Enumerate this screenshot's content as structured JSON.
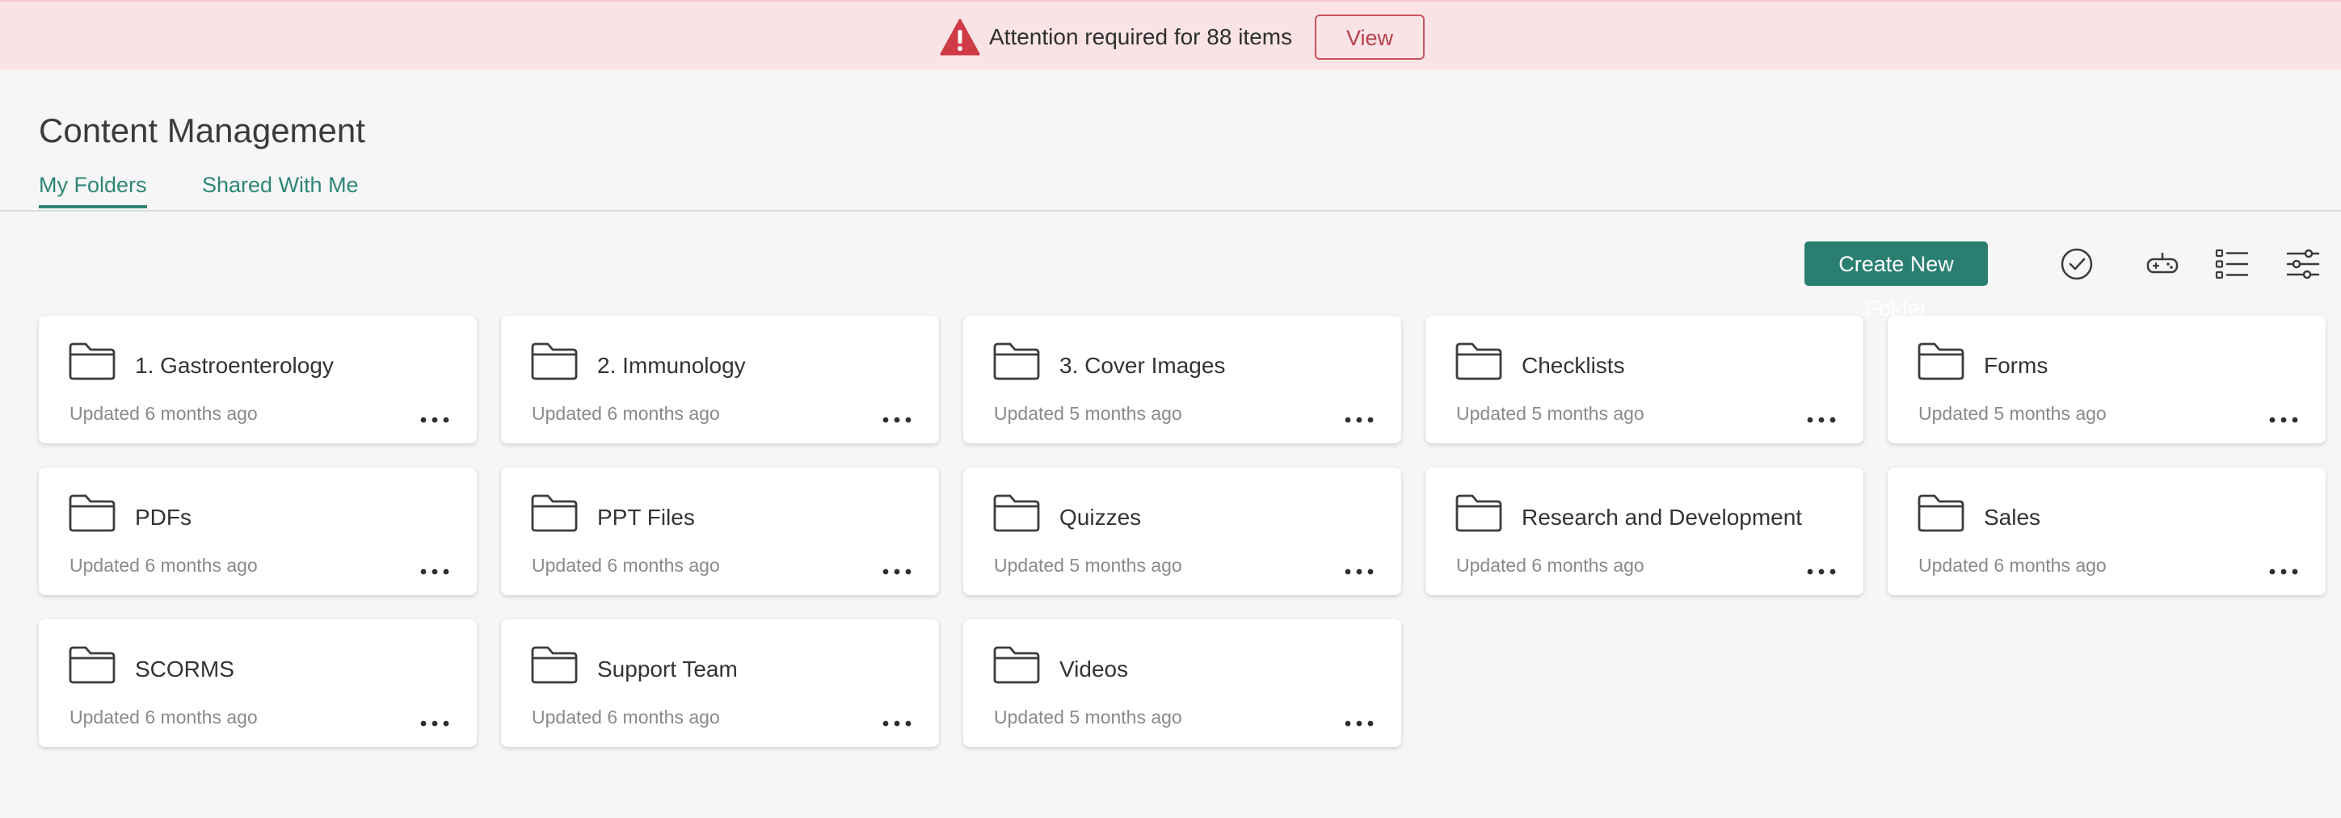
{
  "alert": {
    "icon": "warning-triangle-icon",
    "color": "#d03a45",
    "background": "#f9e3e5",
    "message": "Attention required for 88 items",
    "view_label": "View"
  },
  "header": {
    "title": "Content Management",
    "tabs": [
      {
        "label": "My Folders",
        "active": true
      },
      {
        "label": "Shared With Me",
        "active": false
      }
    ]
  },
  "toolbar": {
    "create_label": "Create New Folder",
    "accent": "#2b7f72",
    "icons": [
      "check-circle-icon",
      "gamepad-icon",
      "list-view-icon",
      "filter-sliders-icon"
    ]
  },
  "folders": [
    {
      "name": "1. Gastroenterology",
      "updated": "Updated 6 months ago"
    },
    {
      "name": "2. Immunology",
      "updated": "Updated 6 months ago"
    },
    {
      "name": "3. Cover Images",
      "updated": "Updated 5 months ago"
    },
    {
      "name": "Checklists",
      "updated": "Updated 5 months ago"
    },
    {
      "name": "Forms",
      "updated": "Updated 5 months ago"
    },
    {
      "name": "PDFs",
      "updated": "Updated 6 months ago"
    },
    {
      "name": "PPT Files",
      "updated": "Updated 6 months ago"
    },
    {
      "name": "Quizzes",
      "updated": "Updated 5 months ago"
    },
    {
      "name": "Research and Development",
      "updated": "Updated 6 months ago"
    },
    {
      "name": "Sales",
      "updated": "Updated 6 months ago"
    },
    {
      "name": "SCORMS",
      "updated": "Updated 6 months ago"
    },
    {
      "name": "Support Team",
      "updated": "Updated 6 months ago"
    },
    {
      "name": "Videos",
      "updated": "Updated 5 months ago"
    }
  ]
}
